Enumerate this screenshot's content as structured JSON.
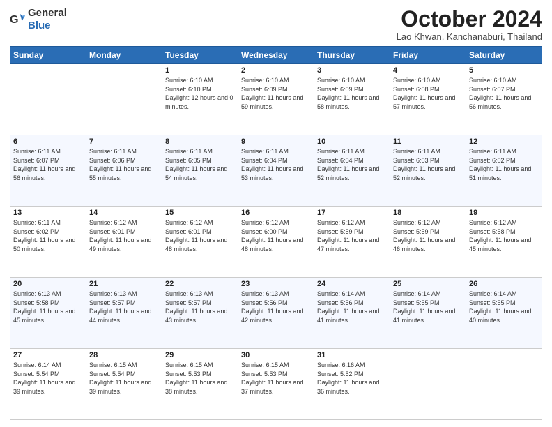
{
  "header": {
    "logo_general": "General",
    "logo_blue": "Blue",
    "title": "October 2024",
    "subtitle": "Lao Khwan, Kanchanaburi, Thailand"
  },
  "days_of_week": [
    "Sunday",
    "Monday",
    "Tuesday",
    "Wednesday",
    "Thursday",
    "Friday",
    "Saturday"
  ],
  "weeks": [
    [
      {
        "day": "",
        "sunrise": "",
        "sunset": "",
        "daylight": ""
      },
      {
        "day": "",
        "sunrise": "",
        "sunset": "",
        "daylight": ""
      },
      {
        "day": "1",
        "sunrise": "Sunrise: 6:10 AM",
        "sunset": "Sunset: 6:10 PM",
        "daylight": "Daylight: 12 hours and 0 minutes."
      },
      {
        "day": "2",
        "sunrise": "Sunrise: 6:10 AM",
        "sunset": "Sunset: 6:09 PM",
        "daylight": "Daylight: 11 hours and 59 minutes."
      },
      {
        "day": "3",
        "sunrise": "Sunrise: 6:10 AM",
        "sunset": "Sunset: 6:09 PM",
        "daylight": "Daylight: 11 hours and 58 minutes."
      },
      {
        "day": "4",
        "sunrise": "Sunrise: 6:10 AM",
        "sunset": "Sunset: 6:08 PM",
        "daylight": "Daylight: 11 hours and 57 minutes."
      },
      {
        "day": "5",
        "sunrise": "Sunrise: 6:10 AM",
        "sunset": "Sunset: 6:07 PM",
        "daylight": "Daylight: 11 hours and 56 minutes."
      }
    ],
    [
      {
        "day": "6",
        "sunrise": "Sunrise: 6:11 AM",
        "sunset": "Sunset: 6:07 PM",
        "daylight": "Daylight: 11 hours and 56 minutes."
      },
      {
        "day": "7",
        "sunrise": "Sunrise: 6:11 AM",
        "sunset": "Sunset: 6:06 PM",
        "daylight": "Daylight: 11 hours and 55 minutes."
      },
      {
        "day": "8",
        "sunrise": "Sunrise: 6:11 AM",
        "sunset": "Sunset: 6:05 PM",
        "daylight": "Daylight: 11 hours and 54 minutes."
      },
      {
        "day": "9",
        "sunrise": "Sunrise: 6:11 AM",
        "sunset": "Sunset: 6:04 PM",
        "daylight": "Daylight: 11 hours and 53 minutes."
      },
      {
        "day": "10",
        "sunrise": "Sunrise: 6:11 AM",
        "sunset": "Sunset: 6:04 PM",
        "daylight": "Daylight: 11 hours and 52 minutes."
      },
      {
        "day": "11",
        "sunrise": "Sunrise: 6:11 AM",
        "sunset": "Sunset: 6:03 PM",
        "daylight": "Daylight: 11 hours and 52 minutes."
      },
      {
        "day": "12",
        "sunrise": "Sunrise: 6:11 AM",
        "sunset": "Sunset: 6:02 PM",
        "daylight": "Daylight: 11 hours and 51 minutes."
      }
    ],
    [
      {
        "day": "13",
        "sunrise": "Sunrise: 6:11 AM",
        "sunset": "Sunset: 6:02 PM",
        "daylight": "Daylight: 11 hours and 50 minutes."
      },
      {
        "day": "14",
        "sunrise": "Sunrise: 6:12 AM",
        "sunset": "Sunset: 6:01 PM",
        "daylight": "Daylight: 11 hours and 49 minutes."
      },
      {
        "day": "15",
        "sunrise": "Sunrise: 6:12 AM",
        "sunset": "Sunset: 6:01 PM",
        "daylight": "Daylight: 11 hours and 48 minutes."
      },
      {
        "day": "16",
        "sunrise": "Sunrise: 6:12 AM",
        "sunset": "Sunset: 6:00 PM",
        "daylight": "Daylight: 11 hours and 48 minutes."
      },
      {
        "day": "17",
        "sunrise": "Sunrise: 6:12 AM",
        "sunset": "Sunset: 5:59 PM",
        "daylight": "Daylight: 11 hours and 47 minutes."
      },
      {
        "day": "18",
        "sunrise": "Sunrise: 6:12 AM",
        "sunset": "Sunset: 5:59 PM",
        "daylight": "Daylight: 11 hours and 46 minutes."
      },
      {
        "day": "19",
        "sunrise": "Sunrise: 6:12 AM",
        "sunset": "Sunset: 5:58 PM",
        "daylight": "Daylight: 11 hours and 45 minutes."
      }
    ],
    [
      {
        "day": "20",
        "sunrise": "Sunrise: 6:13 AM",
        "sunset": "Sunset: 5:58 PM",
        "daylight": "Daylight: 11 hours and 45 minutes."
      },
      {
        "day": "21",
        "sunrise": "Sunrise: 6:13 AM",
        "sunset": "Sunset: 5:57 PM",
        "daylight": "Daylight: 11 hours and 44 minutes."
      },
      {
        "day": "22",
        "sunrise": "Sunrise: 6:13 AM",
        "sunset": "Sunset: 5:57 PM",
        "daylight": "Daylight: 11 hours and 43 minutes."
      },
      {
        "day": "23",
        "sunrise": "Sunrise: 6:13 AM",
        "sunset": "Sunset: 5:56 PM",
        "daylight": "Daylight: 11 hours and 42 minutes."
      },
      {
        "day": "24",
        "sunrise": "Sunrise: 6:14 AM",
        "sunset": "Sunset: 5:56 PM",
        "daylight": "Daylight: 11 hours and 41 minutes."
      },
      {
        "day": "25",
        "sunrise": "Sunrise: 6:14 AM",
        "sunset": "Sunset: 5:55 PM",
        "daylight": "Daylight: 11 hours and 41 minutes."
      },
      {
        "day": "26",
        "sunrise": "Sunrise: 6:14 AM",
        "sunset": "Sunset: 5:55 PM",
        "daylight": "Daylight: 11 hours and 40 minutes."
      }
    ],
    [
      {
        "day": "27",
        "sunrise": "Sunrise: 6:14 AM",
        "sunset": "Sunset: 5:54 PM",
        "daylight": "Daylight: 11 hours and 39 minutes."
      },
      {
        "day": "28",
        "sunrise": "Sunrise: 6:15 AM",
        "sunset": "Sunset: 5:54 PM",
        "daylight": "Daylight: 11 hours and 39 minutes."
      },
      {
        "day": "29",
        "sunrise": "Sunrise: 6:15 AM",
        "sunset": "Sunset: 5:53 PM",
        "daylight": "Daylight: 11 hours and 38 minutes."
      },
      {
        "day": "30",
        "sunrise": "Sunrise: 6:15 AM",
        "sunset": "Sunset: 5:53 PM",
        "daylight": "Daylight: 11 hours and 37 minutes."
      },
      {
        "day": "31",
        "sunrise": "Sunrise: 6:16 AM",
        "sunset": "Sunset: 5:52 PM",
        "daylight": "Daylight: 11 hours and 36 minutes."
      },
      {
        "day": "",
        "sunrise": "",
        "sunset": "",
        "daylight": ""
      },
      {
        "day": "",
        "sunrise": "",
        "sunset": "",
        "daylight": ""
      }
    ]
  ]
}
